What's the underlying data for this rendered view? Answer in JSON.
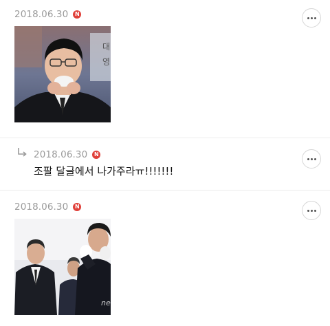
{
  "comments": [
    {
      "date": "2018.06.30",
      "badge": "N",
      "image": "photo-man-covering-mouth-with-handkerchief",
      "more_icon": "more-dots-icon"
    },
    {
      "is_reply": true,
      "reply_icon": "reply-arrow-icon",
      "date": "2018.06.30",
      "badge": "N",
      "text": "조팔 달글에서 나가주라ㅠ!!!!!!!",
      "more_icon": "more-dots-icon"
    },
    {
      "date": "2018.06.30",
      "badge": "N",
      "image": "photo-men-in-suits-at-ceremony",
      "watermark": "news",
      "more_icon": "more-dots-icon"
    }
  ],
  "colors": {
    "badge": "#e0403a",
    "date": "#9a9a9a",
    "divider": "#ebebeb"
  }
}
